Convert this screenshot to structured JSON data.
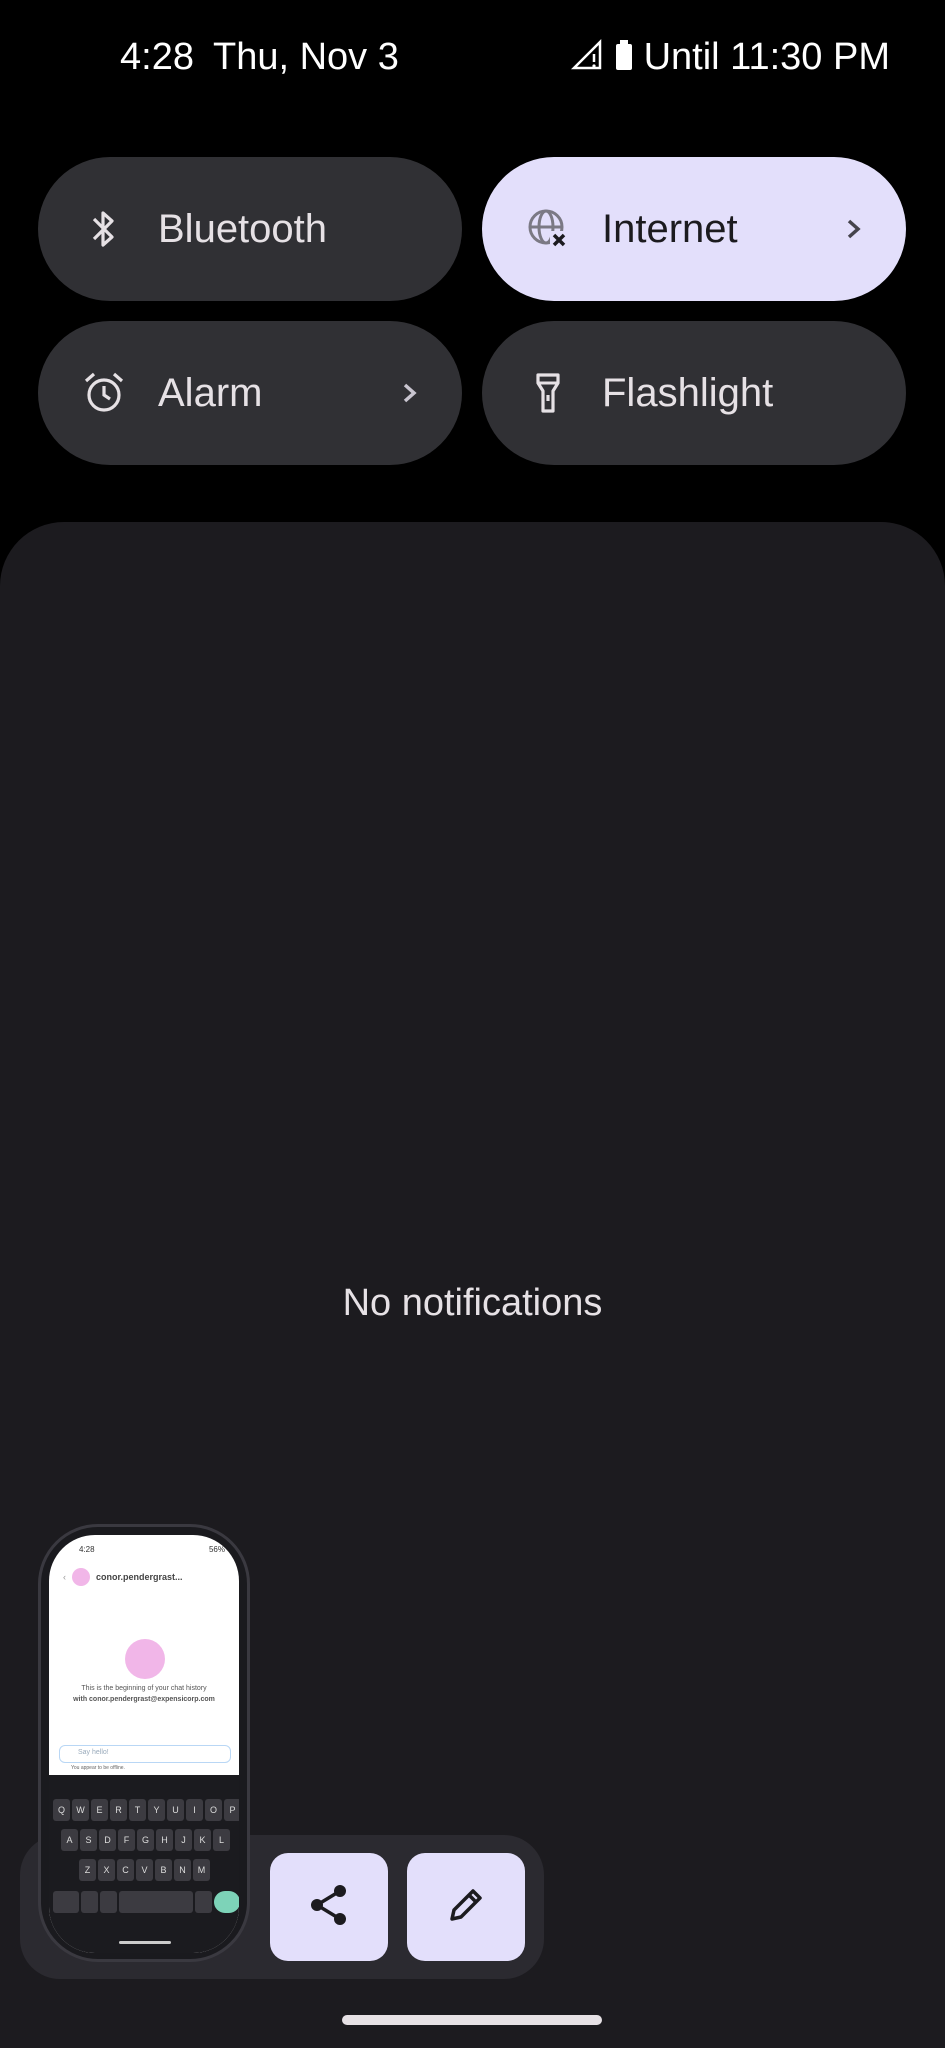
{
  "status_bar": {
    "time": "4:28",
    "date": "Thu, Nov 3",
    "battery_text": "Until 11:30 PM"
  },
  "quick_tiles": [
    {
      "label": "Bluetooth",
      "icon": "bluetooth-icon",
      "active": false,
      "has_chevron": false
    },
    {
      "label": "Internet",
      "icon": "globe-no-connection-icon",
      "active": true,
      "has_chevron": true
    },
    {
      "label": "Alarm",
      "icon": "alarm-clock-icon",
      "active": false,
      "has_chevron": true
    },
    {
      "label": "Flashlight",
      "icon": "flashlight-icon",
      "active": false,
      "has_chevron": false
    }
  ],
  "notifications": {
    "empty_text": "No notifications"
  },
  "screenshot_preview": {
    "status_time": "4:28",
    "status_battery": "56%",
    "contact_name": "conor.pendergrast...",
    "line1": "This is the beginning of your chat history",
    "line2": "with conor.pendergrast@expensicorp.com",
    "composer_placeholder": "Say hello!",
    "offline_note": "You appear to be offline.",
    "keyboard_rows": [
      [
        "Q",
        "W",
        "E",
        "R",
        "T",
        "Y",
        "U",
        "I",
        "O",
        "P"
      ],
      [
        "A",
        "S",
        "D",
        "F",
        "G",
        "H",
        "J",
        "K",
        "L"
      ],
      [
        "Z",
        "X",
        "C",
        "V",
        "B",
        "N",
        "M"
      ]
    ]
  },
  "actions": {
    "share_icon": "share-icon",
    "edit_icon": "pencil-edit-icon"
  },
  "colors": {
    "background": "#000000",
    "panel": "#1c1b1f",
    "tile": "#303034",
    "tile_active": "#e3dffb"
  }
}
